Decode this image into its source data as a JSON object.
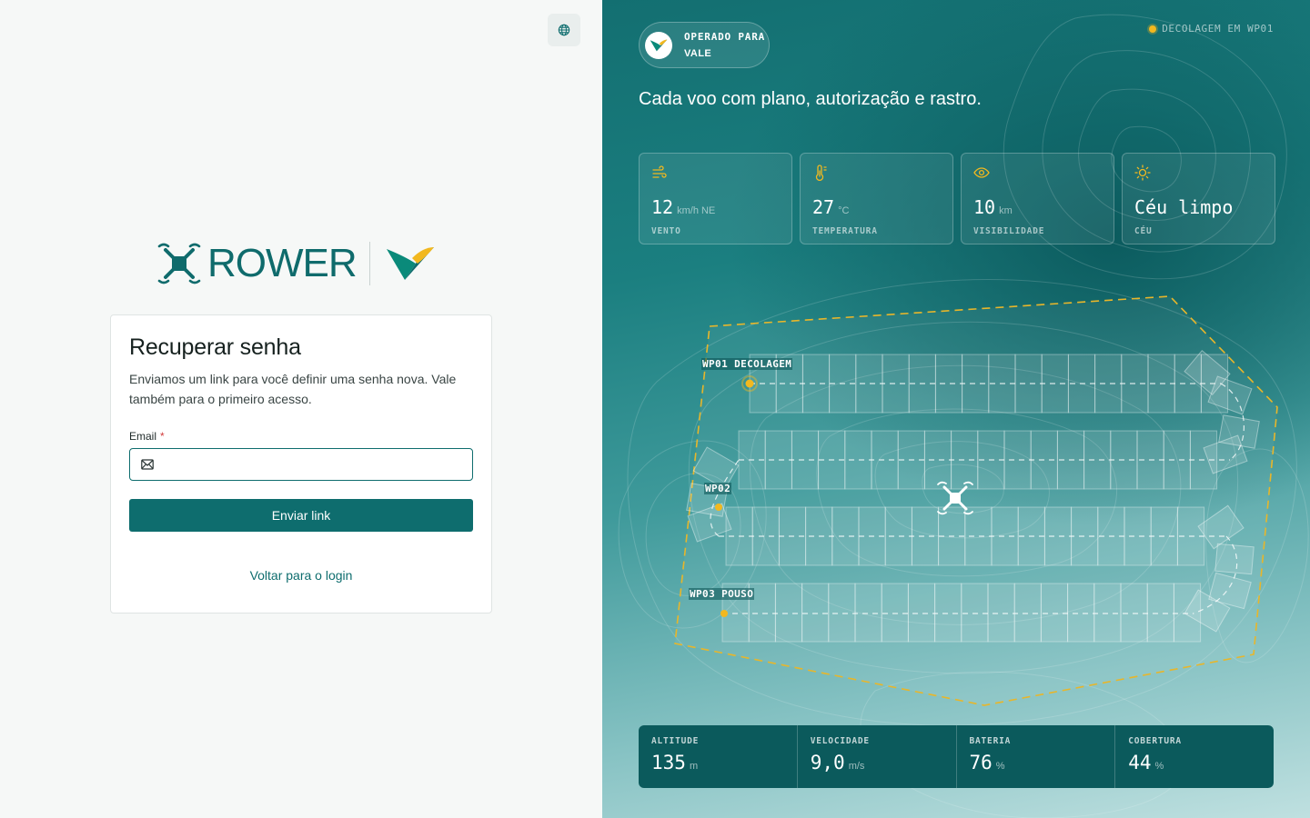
{
  "brand": {
    "name": "ROWER",
    "partner": "Vale",
    "colors": {
      "primary": "#0e6d6e",
      "accent": "#f2b81f",
      "vale_green": "#0a8a7a",
      "vale_yellow": "#f2b81f"
    }
  },
  "header": {
    "language_icon": "globe-icon"
  },
  "form": {
    "title": "Recuperar senha",
    "description": "Enviamos um link para você definir uma senha nova. Vale também para o primeiro acesso.",
    "email_label": "Email",
    "email_required_mark": "*",
    "email_value": "",
    "email_placeholder": "",
    "email_icon": "mail-icon",
    "submit_label": "Enviar link",
    "back_label": "Voltar para o login"
  },
  "hero": {
    "operator_line1": "OPERADO PARA",
    "operator_line2": "VALE",
    "status": "DECOLAGEM EM WP01",
    "headline": "Cada voo com plano, autorização e rastro.",
    "weather": [
      {
        "icon": "wind-icon",
        "value": "12",
        "unit": "km/h NE",
        "label": "VENTO"
      },
      {
        "icon": "thermometer-icon",
        "value": "27",
        "unit": "°C",
        "label": "TEMPERATURA"
      },
      {
        "icon": "eye-icon",
        "value": "10",
        "unit": "km",
        "label": "VISIBILIDADE"
      },
      {
        "icon": "sun-icon",
        "value": "Céu limpo",
        "unit": "",
        "label": "CÉU"
      }
    ],
    "waypoints": [
      {
        "id": "wp01",
        "label": "WP01 DECOLAGEM"
      },
      {
        "id": "wp02",
        "label": "WP02"
      },
      {
        "id": "wp03",
        "label": "WP03 POUSO"
      }
    ],
    "telemetry": [
      {
        "label": "ALTITUDE",
        "value": "135",
        "unit": "m"
      },
      {
        "label": "VELOCIDADE",
        "value": "9,0",
        "unit": "m/s"
      },
      {
        "label": "BATERIA",
        "value": "76",
        "unit": "%"
      },
      {
        "label": "COBERTURA",
        "value": "44",
        "unit": "%"
      }
    ]
  }
}
